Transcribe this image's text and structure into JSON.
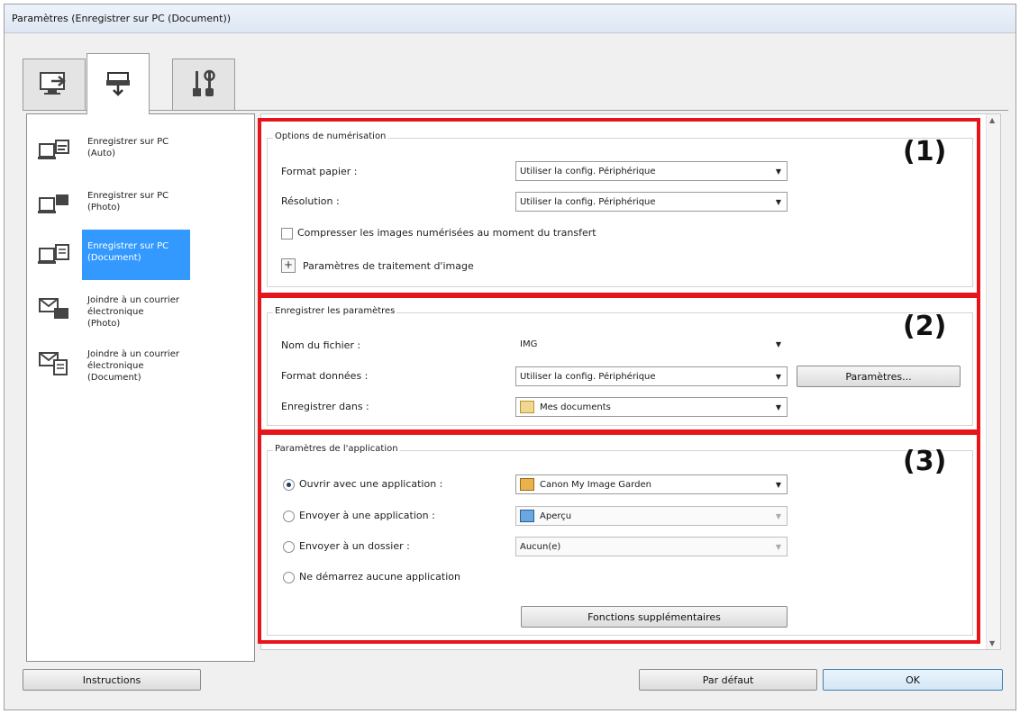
{
  "window": {
    "title": "Paramètres (Enregistrer sur PC (Document))"
  },
  "tabs": [
    {
      "icon": "scan-from-computer-icon"
    },
    {
      "icon": "scan-from-operation-panel-icon",
      "active": true
    },
    {
      "icon": "general-settings-icon"
    }
  ],
  "sidebar": {
    "items": [
      {
        "label": "Enregistrer sur PC\n(Auto)",
        "icon": "save-to-pc-auto-icon"
      },
      {
        "label": "Enregistrer sur PC\n(Photo)",
        "icon": "save-to-pc-photo-icon"
      },
      {
        "label": "Enregistrer sur PC\n(Document)",
        "icon": "save-to-pc-document-icon",
        "selected": true
      },
      {
        "label": "Joindre à un courrier\nélectronique\n(Photo)",
        "icon": "email-photo-icon"
      },
      {
        "label": "Joindre à un courrier\nélectronique\n(Document)",
        "icon": "email-document-icon"
      }
    ]
  },
  "section1": {
    "number": "(1)",
    "group_title": "Options de numérisation",
    "paper_size_label": "Format papier :",
    "paper_size_value": "Utiliser la config. Périphérique",
    "resolution_label": "Résolution :",
    "resolution_value": "Utiliser la config. Périphérique",
    "compress_label": "Compresser les images numérisées au moment du transfert",
    "compress_checked": false,
    "image_processing_label": "Paramètres de traitement d'image"
  },
  "section2": {
    "number": "(2)",
    "group_title": "Enregistrer les paramètres",
    "file_name_label": "Nom du fichier :",
    "file_name_value": "IMG",
    "data_format_label": "Format données :",
    "data_format_value": "Utiliser la config. Périphérique",
    "settings_button": "Paramètres...",
    "save_in_label": "Enregistrer dans :",
    "save_in_value": "Mes documents"
  },
  "section3": {
    "number": "(3)",
    "group_title": "Paramètres de l'application",
    "open_with_label": "Ouvrir avec une application :",
    "open_with_value": "Canon My Image Garden",
    "send_to_app_label": "Envoyer à une application :",
    "send_to_app_value": "Aperçu",
    "send_to_folder_label": "Envoyer à un dossier :",
    "send_to_folder_value": "Aucun(e)",
    "no_app_label": "Ne démarrez aucune application",
    "more_functions_button": "Fonctions supplémentaires",
    "selected_option": "open_with"
  },
  "footer": {
    "instructions_button": "Instructions",
    "default_button": "Par défaut",
    "ok_button": "OK"
  },
  "colors": {
    "highlight": "#e8141c",
    "selection": "#3399ff"
  }
}
